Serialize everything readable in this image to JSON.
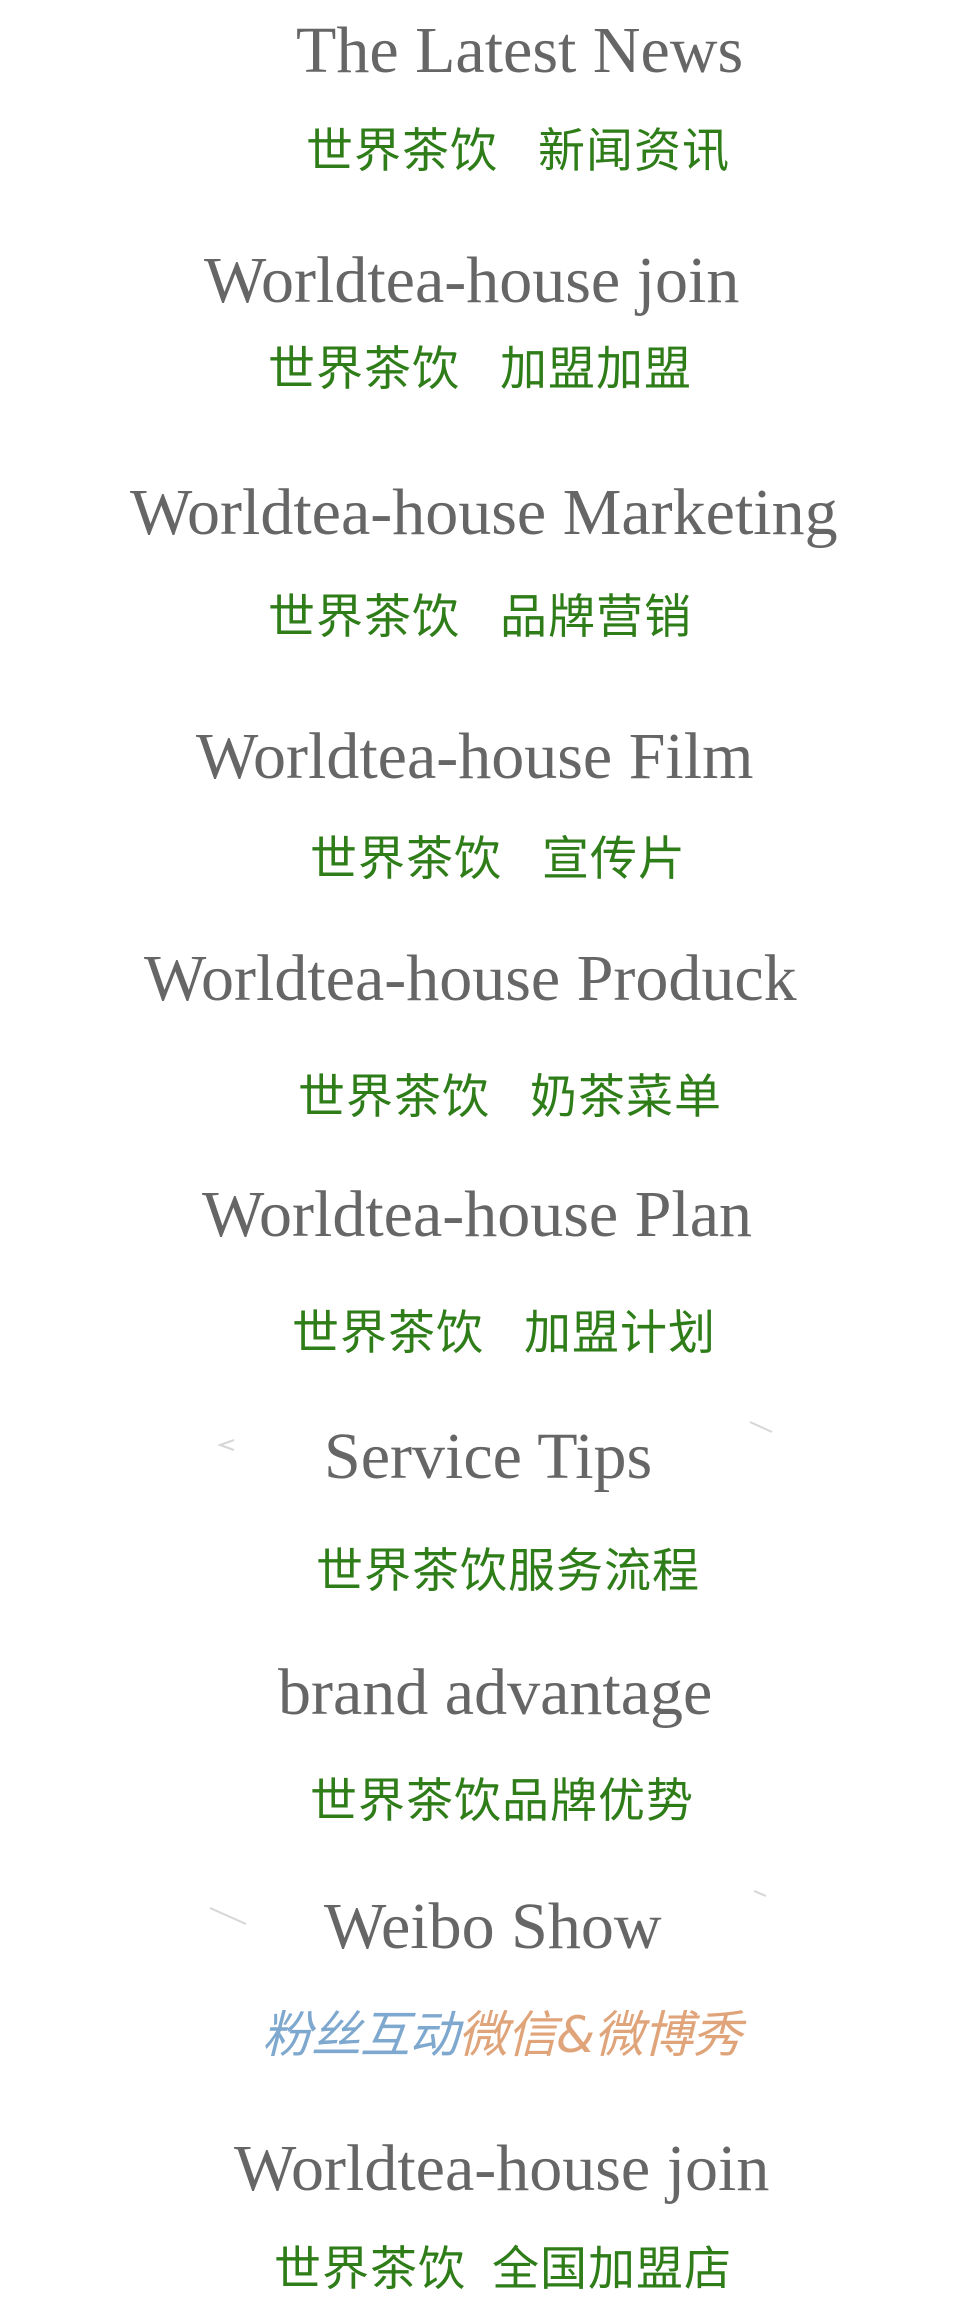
{
  "colors": {
    "title": "#666666",
    "subtitle_green": "#2e7d19",
    "weibo_blue": "#7fa8cf",
    "weibo_orange": "#e0a47a",
    "deco_gray": "#d6d6d6"
  },
  "sections": [
    {
      "title": "The Latest News",
      "sub_a": "世界茶饮",
      "sub_b": "新闻资讯"
    },
    {
      "title": "Worldtea-house join",
      "sub_a": "世界茶饮",
      "sub_b": "加盟加盟"
    },
    {
      "title": "Worldtea-house Marketing",
      "sub_a": "世界茶饮",
      "sub_b": "品牌营销"
    },
    {
      "title": "Worldtea-house Film",
      "sub_a": "世界茶饮",
      "sub_b": "宣传片"
    },
    {
      "title": "Worldtea-house Produck",
      "sub_a": "世界茶饮",
      "sub_b": "奶茶菜单"
    },
    {
      "title": "Worldtea-house Plan",
      "sub_a": "世界茶饮",
      "sub_b": "加盟计划"
    },
    {
      "title": "Service Tips",
      "sub": "世界茶饮服务流程"
    },
    {
      "title": "brand advantage",
      "sub": "世界茶饮品牌优势"
    },
    {
      "title": "Weibo Show",
      "sub_blue": "粉丝互动",
      "sub_orange": "微信&微博秀"
    },
    {
      "title": "Worldtea-house join",
      "sub_a": "世界茶饮",
      "sub_b": "全国加盟店"
    }
  ]
}
